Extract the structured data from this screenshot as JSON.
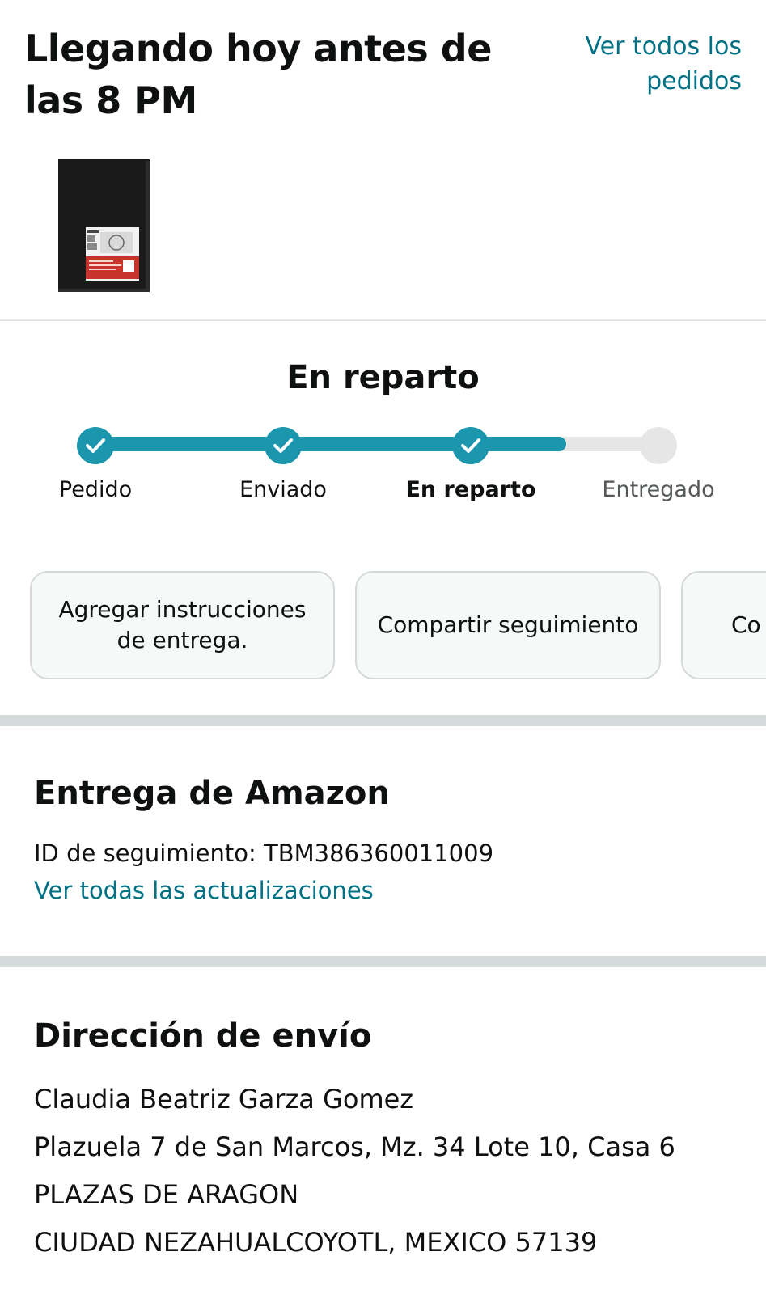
{
  "header": {
    "title": "Llegando hoy antes de las 8 PM",
    "all_orders_link": "Ver todos los pedidos"
  },
  "product": {
    "image_icon": "sketchbook-icon",
    "brand_text": "CANSON",
    "product_text": "ART BOOK ONE"
  },
  "tracking": {
    "status_title": "En reparto",
    "progress": 0.82,
    "steps": [
      {
        "label": "Pedido",
        "state": "done"
      },
      {
        "label": "Enviado",
        "state": "done"
      },
      {
        "label": "En reparto",
        "state": "current"
      },
      {
        "label": "Entregado",
        "state": "pending"
      }
    ]
  },
  "actions": [
    {
      "label": "Agregar instrucciones de entrega."
    },
    {
      "label": "Compartir seguimiento"
    },
    {
      "label": "Co"
    }
  ],
  "carrier": {
    "title": "Entrega de Amazon",
    "tracking_id": "ID de seguimiento: TBM386360011009",
    "updates_link": "Ver todas las actualizaciones"
  },
  "shipping": {
    "title": "Dirección de envío",
    "lines": [
      "Claudia Beatriz Garza Gomez",
      "Plazuela 7 de San Marcos, Mz. 34 Lote 10, Casa 6",
      "PLAZAS DE ARAGON",
      "CIUDAD NEZAHUALCOYOTL, MEXICO 57139"
    ]
  },
  "colors": {
    "accent": "#1b96ac",
    "link": "#007185",
    "pending": "#e6e6e6",
    "band": "#d5dbdb"
  }
}
